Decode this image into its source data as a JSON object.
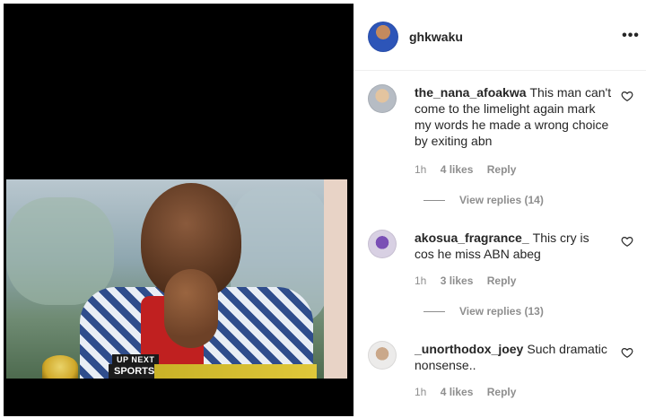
{
  "post": {
    "username": "ghkwaku",
    "more_icon": "more-horizontal-icon",
    "video": {
      "up_next_label": "UP NEXT",
      "segment_label": "SPORTS"
    }
  },
  "comments": [
    {
      "username": "the_nana_afoakwa",
      "text": "This man can't come to the limelight again mark my words he made a wrong choice by exiting abn",
      "time": "1h",
      "likes": "4 likes",
      "reply_label": "Reply",
      "view_replies": "View replies (14)"
    },
    {
      "username": "akosua_fragrance_",
      "text": "This cry is cos he miss ABN abeg",
      "time": "1h",
      "likes": "3 likes",
      "reply_label": "Reply",
      "view_replies": "View replies (13)"
    },
    {
      "username": "_unorthodox_joey",
      "text": "Such dramatic nonsense..",
      "time": "1h",
      "likes": "4 likes",
      "reply_label": "Reply"
    }
  ],
  "colors": {
    "text": "#262626",
    "secondary": "#8e8e8e",
    "divider": "#efefef"
  }
}
